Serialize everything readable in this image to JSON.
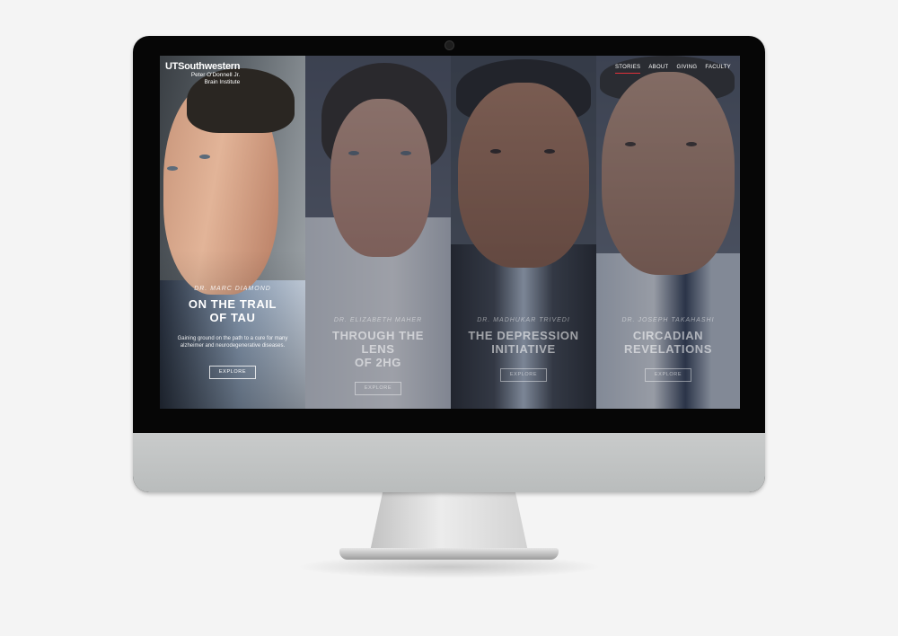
{
  "header": {
    "logo_main": "UTSouthwestern",
    "logo_sub_line1": "Peter O'Donnell Jr.",
    "logo_sub_line2": "Brain Institute"
  },
  "nav": {
    "items": [
      "STORIES",
      "ABOUT",
      "GIVING",
      "FACULTY"
    ],
    "active": "STORIES"
  },
  "stories": [
    {
      "doctor": "DR. MARC DIAMOND",
      "title_line1": "ON THE TRAIL",
      "title_line2": "OF TAU",
      "description": "Gaining ground on the path to a cure for many alzheimer and neurodegenerative diseases.",
      "button": "EXPLORE",
      "highlighted": true
    },
    {
      "doctor": "DR. ELIZABETH MAHER",
      "title_line1": "THROUGH THE LENS",
      "title_line2": "OF 2HG",
      "button": "EXPLORE",
      "highlighted": false
    },
    {
      "doctor": "DR. MADHUKAR TRIVEDI",
      "title_line1": "THE DEPRESSION",
      "title_line2": "INITIATIVE",
      "button": "EXPLORE",
      "highlighted": false
    },
    {
      "doctor": "DR. JOSEPH TAKAHASHI",
      "title_line1": "CIRCADIAN",
      "title_line2": "REVELATIONS",
      "button": "EXPLORE",
      "highlighted": false
    }
  ],
  "colors": {
    "accent": "#e0303a",
    "bezel": "#060606",
    "chin": "#c4c6c6"
  }
}
